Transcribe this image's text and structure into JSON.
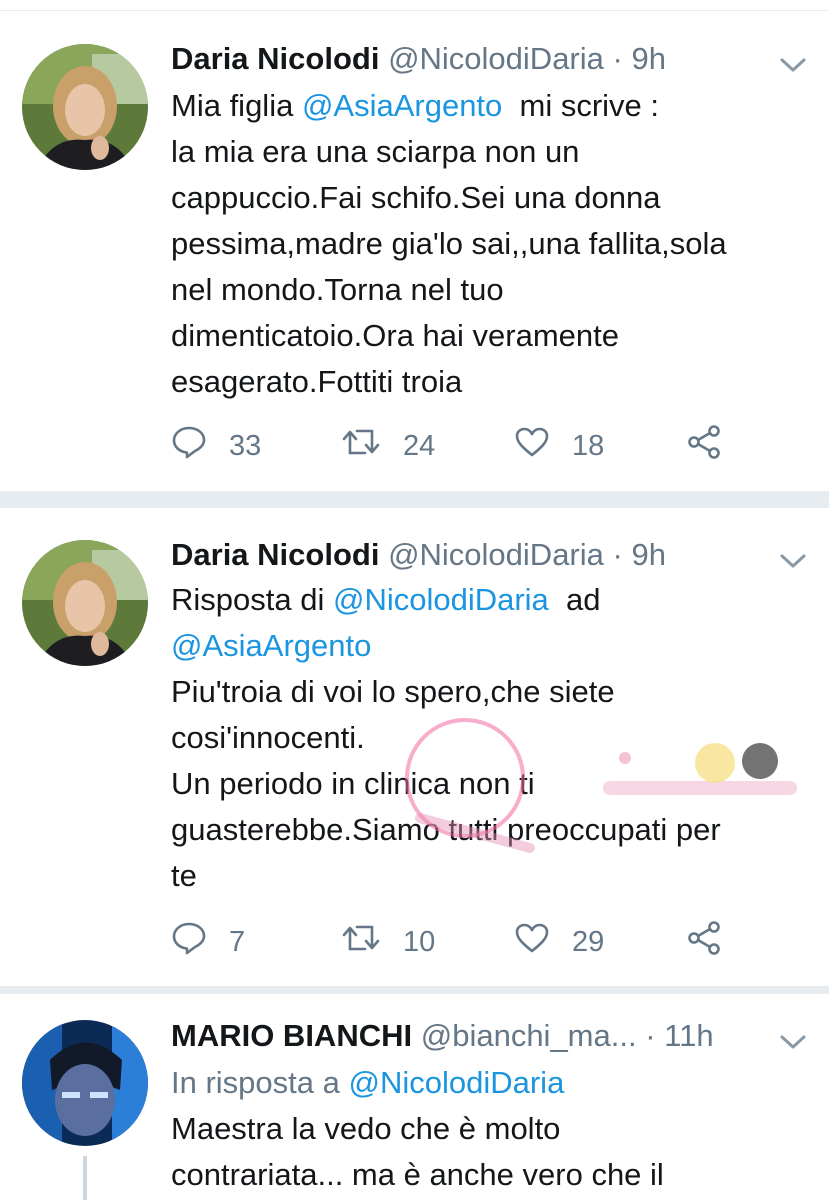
{
  "tweets": [
    {
      "name": "Daria Nicolodi",
      "handle": "@NicolodiDaria",
      "dot": "·",
      "time": "9h",
      "lines": [
        {
          "pre": "Mia figlia ",
          "mention": "@AsiaArgento",
          "post": "  mi scrive :"
        },
        {
          "text": "la mia era una sciarpa non un"
        },
        {
          "text": "cappuccio.Fai schifo.Sei una donna"
        },
        {
          "text": "pessima,madre gia'lo sai,,una fallita,sola"
        },
        {
          "text": "nel mondo.Torna nel tuo"
        },
        {
          "text": "dimenticatoio.Ora hai veramente"
        },
        {
          "text": "esagerato.Fottiti troia"
        }
      ],
      "replies": "33",
      "retweets": "24",
      "likes": "18"
    },
    {
      "name": "Daria Nicolodi",
      "handle": "@NicolodiDaria",
      "dot": "·",
      "time": "9h",
      "reply_prefix": "Risposta di ",
      "reply_mention1": "@NicolodiDaria",
      "reply_mid": "  ad",
      "reply_mention2": "@AsiaArgento",
      "lines": [
        {
          "text": "Piu'troia di voi lo spero,che siete"
        },
        {
          "text": "cosi'innocenti."
        },
        {
          "text": "Un periodo in clinica non ti"
        },
        {
          "text": "guasterebbe.Siamo tutti preoccupati per"
        },
        {
          "text": "te"
        }
      ],
      "replies": "7",
      "retweets": "10",
      "likes": "29"
    },
    {
      "name": "MARIO BIANCHI",
      "handle": "@bianchi_ma...",
      "dot": "·",
      "time": "11h",
      "reply_prefix": "In risposta a ",
      "reply_mention": "@NicolodiDaria",
      "lines": [
        {
          "text": "Maestra la vedo che è molto"
        },
        {
          "text": "contrariata... ma è anche vero che il"
        }
      ]
    }
  ],
  "icons": {
    "reply": "reply-icon",
    "retweet": "retweet-icon",
    "like": "heart-icon",
    "share": "share-icon",
    "more": "chevron-down-icon"
  },
  "colors": {
    "mention": "#1b95e0",
    "secondary_text": "#657786",
    "separator": "#e6ecf0"
  }
}
